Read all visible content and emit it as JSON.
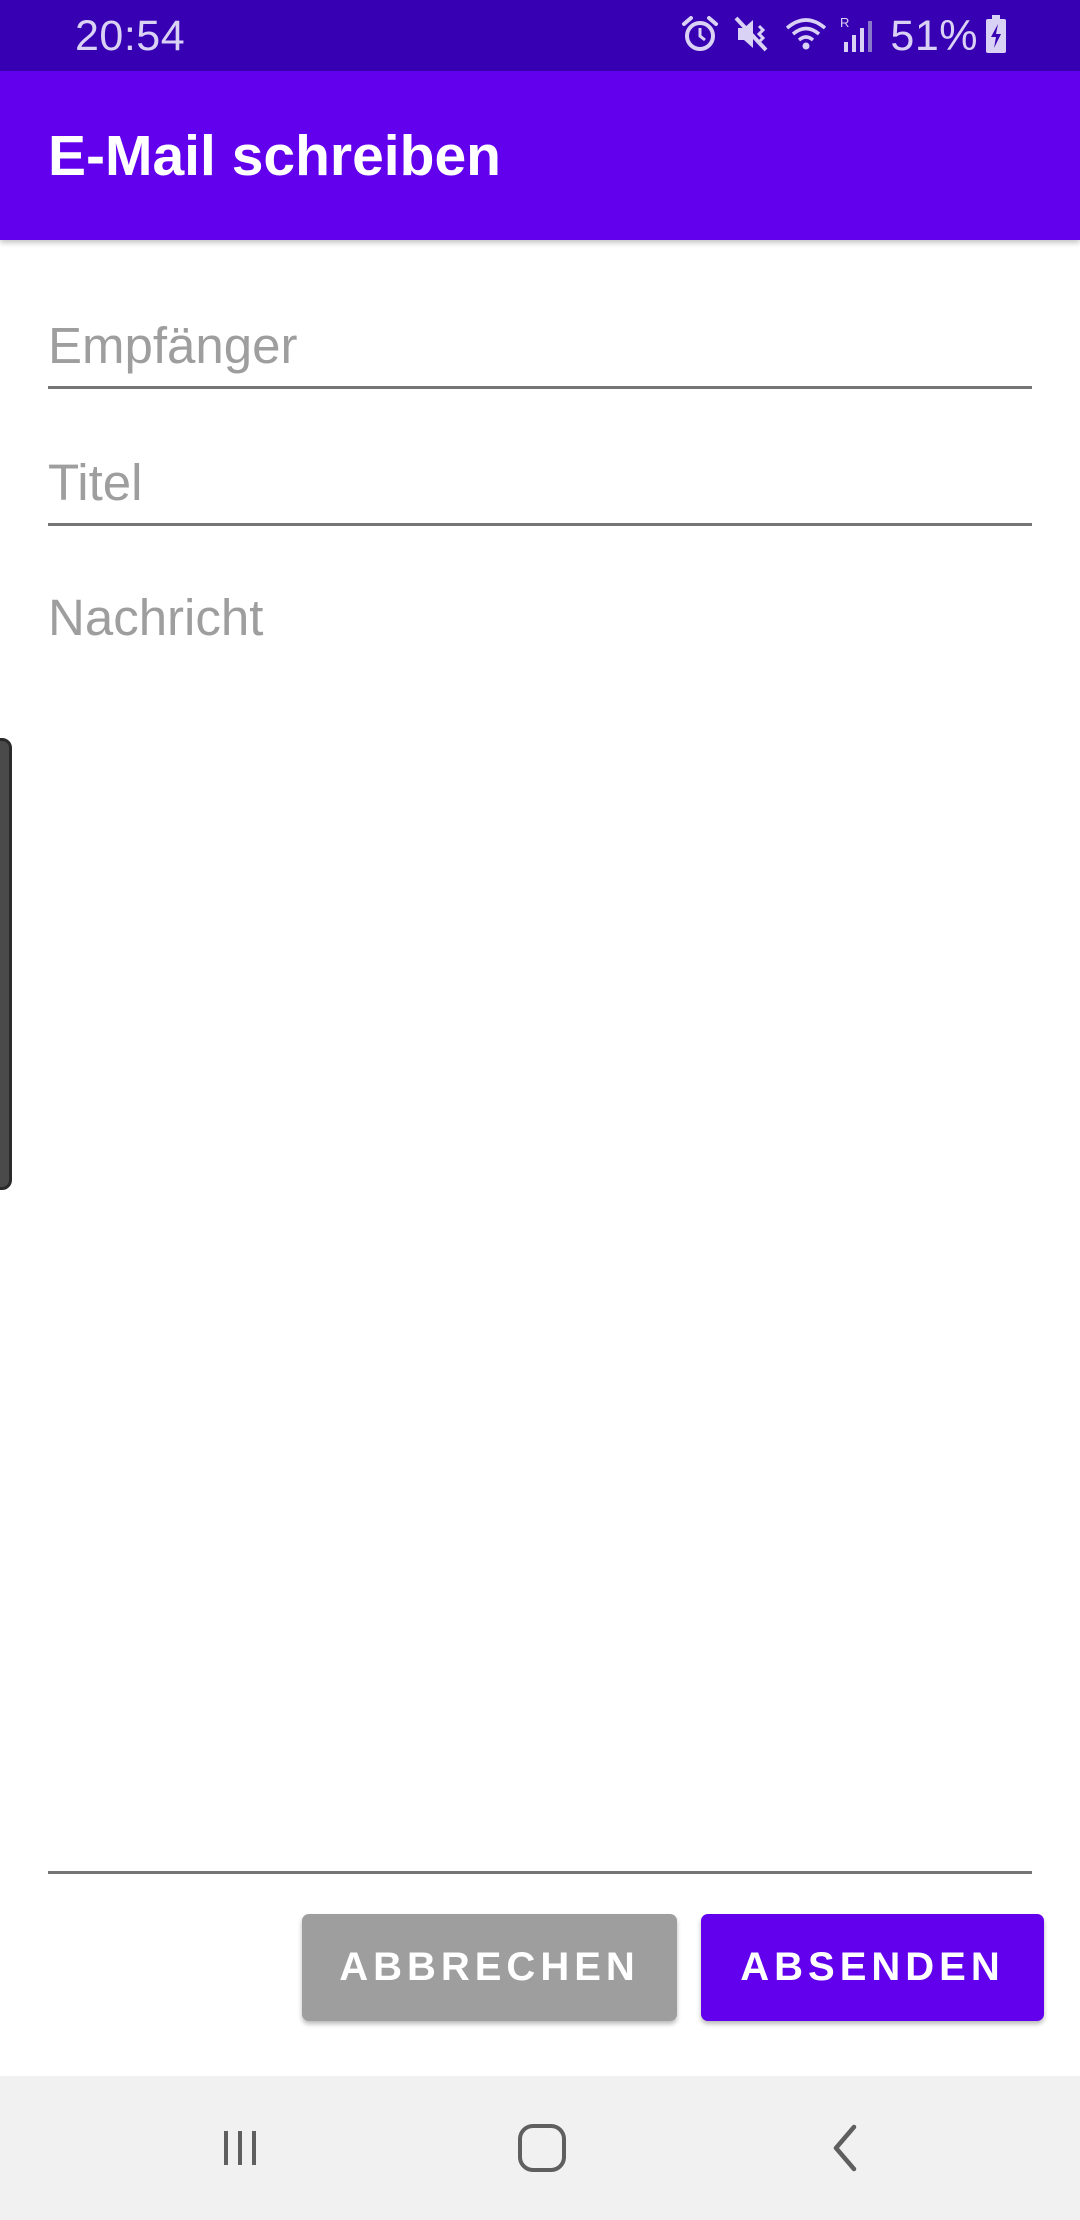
{
  "status_bar": {
    "time": "20:54",
    "battery_percent": "51%",
    "icons": [
      "alarm-icon",
      "vibrate-mute-icon",
      "wifi-icon",
      "signal-icon",
      "battery-charging-icon"
    ],
    "color": "#3700b3"
  },
  "app_bar": {
    "title": "E-Mail schreiben",
    "color": "#6200ee"
  },
  "form": {
    "recipient": {
      "placeholder": "Empfänger",
      "value": ""
    },
    "subject": {
      "placeholder": "Titel",
      "value": ""
    },
    "message": {
      "placeholder": "Nachricht",
      "value": ""
    }
  },
  "actions": {
    "cancel_label": "ABBRECHEN",
    "send_label": "ABSENDEN",
    "cancel_color": "#9e9e9e",
    "send_color": "#6200ee"
  },
  "nav_bar": {
    "buttons": [
      "recent-apps-icon",
      "home-icon",
      "back-icon"
    ]
  }
}
